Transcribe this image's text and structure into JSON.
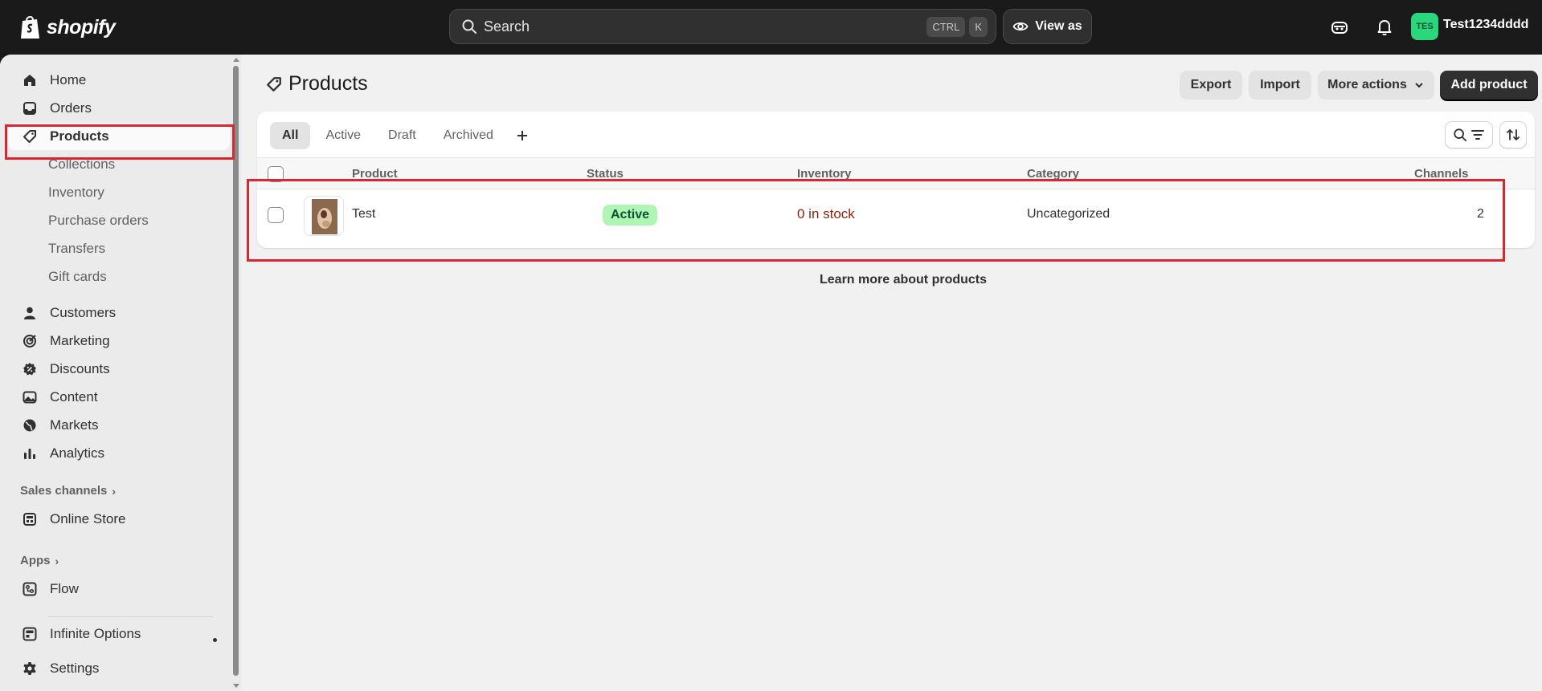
{
  "topbar": {
    "brand": "shopify",
    "search_placeholder": "Search",
    "shortcut_1": "CTRL",
    "shortcut_2": "K",
    "view_as": "View as",
    "avatar_initials": "TES",
    "store_name": "Test1234dddd"
  },
  "sidebar": {
    "home": "Home",
    "orders": "Orders",
    "products": "Products",
    "collections": "Collections",
    "inventory": "Inventory",
    "purchase_orders": "Purchase orders",
    "transfers": "Transfers",
    "gift_cards": "Gift cards",
    "customers": "Customers",
    "marketing": "Marketing",
    "discounts": "Discounts",
    "content": "Content",
    "markets": "Markets",
    "analytics": "Analytics",
    "sales_channels": "Sales channels",
    "online_store": "Online Store",
    "apps": "Apps",
    "flow": "Flow",
    "infinite_options": "Infinite Options",
    "settings": "Settings"
  },
  "page": {
    "title": "Products",
    "export": "Export",
    "import": "Import",
    "more_actions": "More actions",
    "add_product": "Add product",
    "tabs": [
      "All",
      "Active",
      "Draft",
      "Archived"
    ],
    "columns": {
      "product": "Product",
      "status": "Status",
      "inventory": "Inventory",
      "category": "Category",
      "channels": "Channels"
    },
    "rows": [
      {
        "name": "Test",
        "status": "Active",
        "inventory": "0 in stock",
        "category": "Uncategorized",
        "channels": "2"
      }
    ],
    "learn_more": "Learn more about products"
  },
  "colors": {
    "topbar": "#1a1a1a",
    "highlight": "#d92630",
    "badge_active_bg": "#aff5b4",
    "stock_text": "#8e1f0b",
    "avatar": "#2bd77c"
  }
}
